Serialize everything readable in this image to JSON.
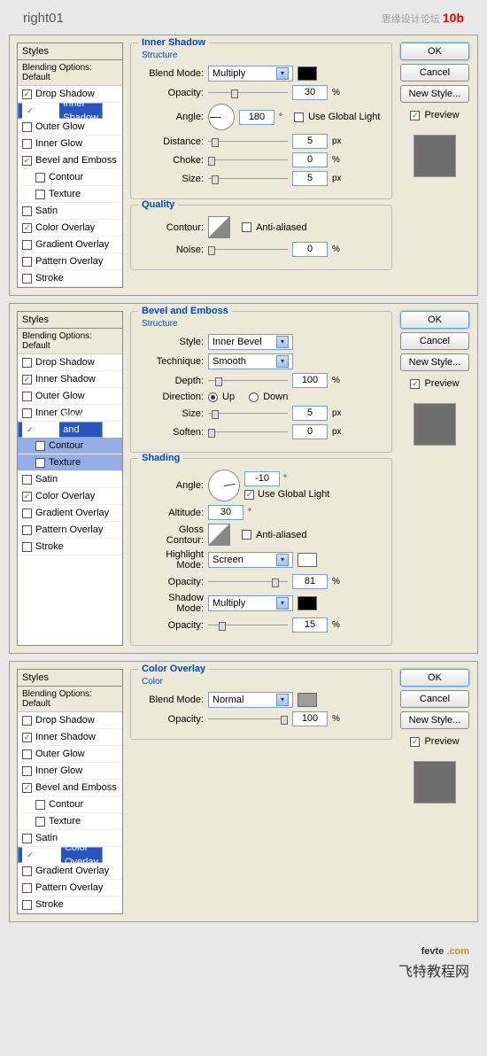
{
  "hdr": {
    "left": "right01",
    "right": "思缘设计论坛",
    "red": "10b"
  },
  "common": {
    "styles_hd": "Styles",
    "blending": "Blending Options: Default",
    "ok": "OK",
    "cancel": "Cancel",
    "newstyle": "New Style...",
    "preview": "Preview"
  },
  "effects": {
    "drop": "Drop Shadow",
    "inner": "Inner Shadow",
    "outerglow": "Outer Glow",
    "innerglow": "Inner Glow",
    "bevel": "Bevel and Emboss",
    "contour": "Contour",
    "texture": "Texture",
    "satin": "Satin",
    "color": "Color Overlay",
    "gradient": "Gradient Overlay",
    "pattern": "Pattern Overlay",
    "stroke": "Stroke"
  },
  "lbl": {
    "blendmode": "Blend Mode:",
    "opacity": "Opacity:",
    "angle": "Angle:",
    "distance": "Distance:",
    "choke": "Choke:",
    "size": "Size:",
    "contour": "Contour:",
    "noise": "Noise:",
    "useglobal": "Use Global Light",
    "antialiased": "Anti-aliased",
    "style": "Style:",
    "technique": "Technique:",
    "depth": "Depth:",
    "direction": "Direction:",
    "up": "Up",
    "down": "Down",
    "soften": "Soften:",
    "altitude": "Altitude:",
    "gloss": "Gloss Contour:",
    "highlight": "Highlight Mode:",
    "shadowmode": "Shadow Mode:",
    "structure": "Structure",
    "quality": "Quality",
    "shading": "Shading",
    "coltitle": "Color"
  },
  "d1": {
    "title": "Inner Shadow",
    "blendmode": "Multiply",
    "opacity": "30",
    "angle": "180",
    "distance": "5",
    "choke": "0",
    "size": "5",
    "noise": "0",
    "sw": "#000"
  },
  "d2": {
    "title": "Bevel and Emboss",
    "style": "Inner Bevel",
    "technique": "Smooth",
    "depth": "100",
    "size": "5",
    "soften": "0",
    "angle": "-10",
    "altitude": "30",
    "highlightmode": "Screen",
    "hiopacity": "81",
    "shadowmode": "Multiply",
    "shopacity": "15",
    "hsw": "#fff",
    "ssw": "#000"
  },
  "d3": {
    "title": "Color Overlay",
    "blendmode": "Normal",
    "opacity": "100",
    "sw": "#9e9e9e"
  },
  "ftr": {
    "b1a": "fevte ",
    "b1b": ".com",
    "b2": "飞特教程网"
  }
}
